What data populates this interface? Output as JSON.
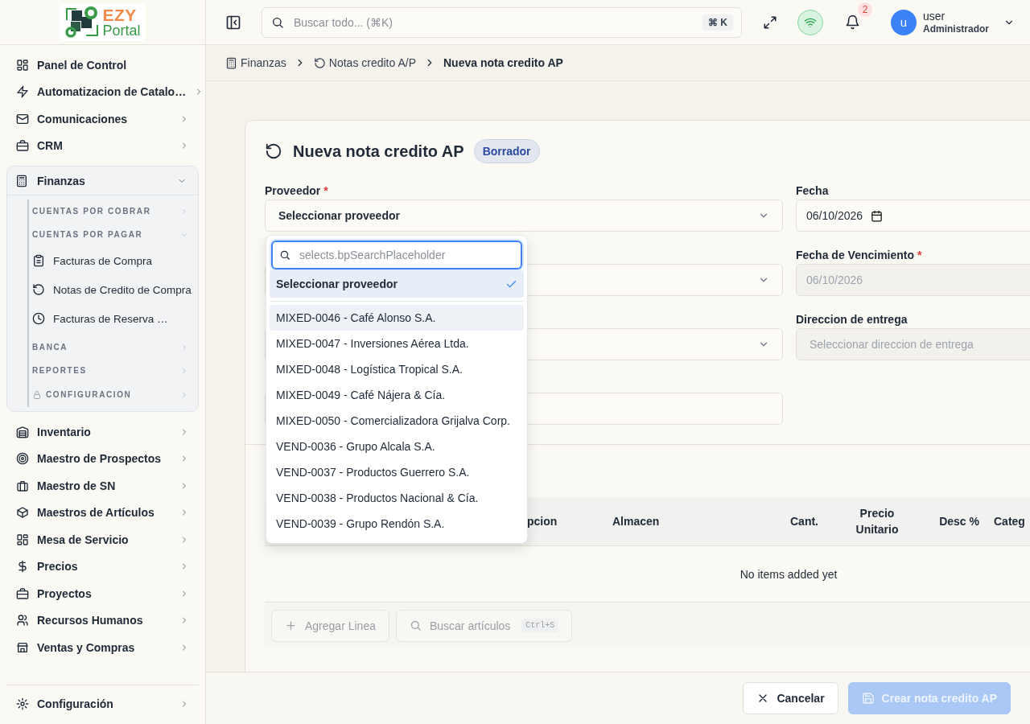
{
  "logo": {
    "primary": "EZY",
    "secondary": "Portal"
  },
  "sidebar": {
    "items": [
      {
        "label": "Panel de Control",
        "expandable": false,
        "expanded": false
      },
      {
        "label": "Automatizacion de Catalo…",
        "expandable": true,
        "expanded": false
      },
      {
        "label": "Comunicaciones",
        "expandable": true,
        "expanded": false
      },
      {
        "label": "CRM",
        "expandable": true,
        "expanded": false
      },
      {
        "label": "Finanzas",
        "expandable": true,
        "expanded": true,
        "sections": [
          {
            "label": "CUENTAS POR COBRAR",
            "expanded": false,
            "locked": false
          },
          {
            "label": "CUENTAS POR PAGAR",
            "expanded": true,
            "locked": false,
            "children": [
              {
                "label": "Facturas de Compra"
              },
              {
                "label": "Notas de Credito de Compra"
              },
              {
                "label": "Facturas de Reserva …"
              }
            ]
          },
          {
            "label": "BANCA",
            "expanded": false,
            "locked": false
          },
          {
            "label": "REPORTES",
            "expanded": false,
            "locked": false
          },
          {
            "label": "CONFIGURACION",
            "expanded": false,
            "locked": true
          }
        ]
      },
      {
        "label": "Inventario",
        "expandable": true,
        "expanded": false
      },
      {
        "label": "Maestro de Prospectos",
        "expandable": true,
        "expanded": false
      },
      {
        "label": "Maestro de SN",
        "expandable": true,
        "expanded": false
      },
      {
        "label": "Maestros de Artículos",
        "expandable": true,
        "expanded": false
      },
      {
        "label": "Mesa de Servicio",
        "expandable": true,
        "expanded": false
      },
      {
        "label": "Precios",
        "expandable": true,
        "expanded": false
      },
      {
        "label": "Proyectos",
        "expandable": true,
        "expanded": false
      },
      {
        "label": "Recursos Humanos",
        "expandable": true,
        "expanded": false
      },
      {
        "label": "Ventas y Compras",
        "expandable": true,
        "expanded": false
      }
    ],
    "footer_items": [
      {
        "label": "Configuración",
        "expandable": true,
        "expanded": false
      }
    ]
  },
  "topbar": {
    "search": {
      "placeholder": "Buscar todo... (⌘K)",
      "shortcut": "⌘ K"
    },
    "connection": {
      "online": true
    },
    "notifications": {
      "count": "2"
    },
    "user": {
      "avatar": "u",
      "name": "user",
      "role": "Administrador"
    }
  },
  "breadcrumb": [
    {
      "label": "Finanzas",
      "current": false
    },
    {
      "label": "Notas credito A/P",
      "current": false
    },
    {
      "label": "Nueva nota credito AP",
      "current": true
    }
  ],
  "form": {
    "title": "Nueva nota credito AP",
    "status": "Borrador",
    "left_fields": [
      {
        "kind": "select",
        "label": "Proveedor",
        "required_mark": "*",
        "value": "Seleccionar proveedor",
        "open": true
      },
      {
        "kind": "select",
        "open": false
      },
      {
        "kind": "select",
        "open": false
      },
      {
        "kind": "text",
        "open": false
      }
    ],
    "right_fields": [
      {
        "kind": "date",
        "label": "Fecha",
        "value": "06/10/2026",
        "disabled": false
      },
      {
        "kind": "date",
        "label": "Fecha de Vencimiento",
        "required_mark": "*",
        "value": "06/10/2026",
        "disabled": true
      },
      {
        "kind": "select",
        "label": "Direccion de entrega",
        "placeholder": "Seleccionar direccion de entrega",
        "disabled": true
      }
    ],
    "dropdown": {
      "search_placeholder": "selects.bpSearchPlaceholder",
      "options": [
        {
          "label": "Seleccionar proveedor",
          "selected": true,
          "highlighted": false
        },
        {
          "label": "MIXED-0046 - Café Alonso S.A.",
          "selected": false,
          "highlighted": true
        },
        {
          "label": "MIXED-0047 - Inversiones Aérea Ltda.",
          "selected": false,
          "highlighted": false
        },
        {
          "label": "MIXED-0048 - Logística Tropical S.A.",
          "selected": false,
          "highlighted": false
        },
        {
          "label": "MIXED-0049 - Café Nájera & Cía.",
          "selected": false,
          "highlighted": false
        },
        {
          "label": "MIXED-0050 - Comercializadora Grijalva Corp.",
          "selected": false,
          "highlighted": false
        },
        {
          "label": "VEND-0036 - Grupo Alcala S.A.",
          "selected": false,
          "highlighted": false
        },
        {
          "label": "VEND-0037 - Productos Guerrero S.A.",
          "selected": false,
          "highlighted": false
        },
        {
          "label": "VEND-0038 - Productos Nacional & Cía.",
          "selected": false,
          "highlighted": false
        },
        {
          "label": "VEND-0039 - Grupo Rendón S.A.",
          "selected": false,
          "highlighted": false
        }
      ]
    },
    "lines": {
      "columns": [
        "pcion",
        "Almacen",
        "Cant.",
        "Precio Unitario",
        "Desc %",
        "Categ"
      ],
      "empty_text": "No items added yet",
      "buttons": [
        {
          "label": "Agregar Linea",
          "disabled": true
        },
        {
          "label": "Buscar artículos",
          "shortcut": "Ctrl+S",
          "disabled": true
        }
      ]
    }
  },
  "footer": {
    "buttons": [
      {
        "label": "Cancelar",
        "kind": "secondary",
        "disabled": false
      },
      {
        "label": "Crear nota credito AP",
        "kind": "primary",
        "disabled": true
      }
    ]
  }
}
